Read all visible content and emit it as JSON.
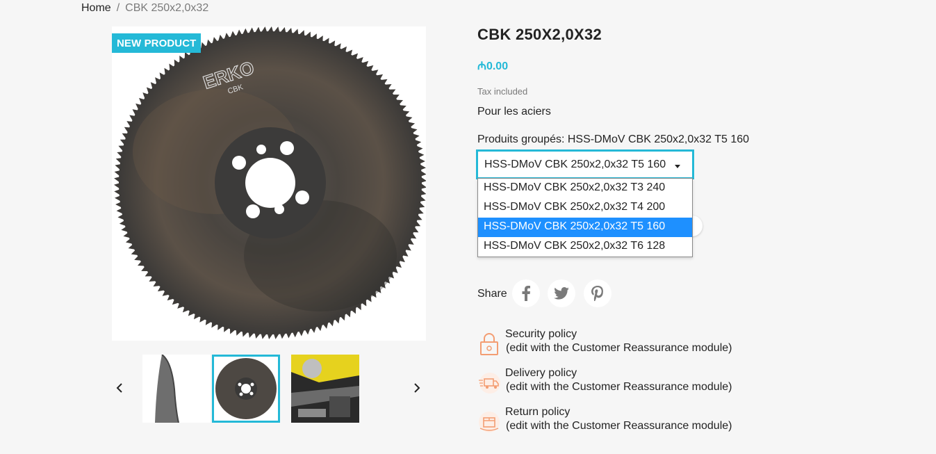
{
  "breadcrumb": {
    "home": "Home",
    "separator": "/",
    "current": "CBK 250x2,0x32"
  },
  "product": {
    "badge": "NEW PRODUCT",
    "title": "CBK 250X2,0X32",
    "price": "₼0.00",
    "tax": "Tax included",
    "description": "Pour les aciers",
    "group_label": "Produits groupés: HSS-DMoV CBK 250x2,0x32 T5 160",
    "logo_text": "ERKO",
    "logo_sub": "CBK"
  },
  "variant_select": {
    "selected": "HSS-DMoV CBK 250x2,0x32 T5 160",
    "options": [
      "HSS-DMoV CBK 250x2,0x32 T3 240",
      "HSS-DMoV CBK 250x2,0x32 T4 200",
      "HSS-DMoV CBK 250x2,0x32 T5 160",
      "HSS-DMoV CBK 250x2,0x32 T6 128"
    ],
    "active_index": 2
  },
  "share": {
    "label": "Share",
    "networks": [
      "facebook-icon",
      "twitter-icon",
      "pinterest-icon"
    ]
  },
  "reassurance": [
    {
      "title": "Security policy",
      "subtitle": "(edit with the Customer Reassurance module)",
      "icon": "lock-icon"
    },
    {
      "title": "Delivery policy",
      "subtitle": "(edit with the Customer Reassurance module)",
      "icon": "delivery-truck-icon"
    },
    {
      "title": "Return policy",
      "subtitle": "(edit with the Customer Reassurance module)",
      "icon": "return-box-icon"
    }
  ],
  "colors": {
    "accent": "#24b9d7",
    "select_highlight": "#1e90ff",
    "reassurance_icon": "#f39d72",
    "background": "#f6f6f6"
  }
}
